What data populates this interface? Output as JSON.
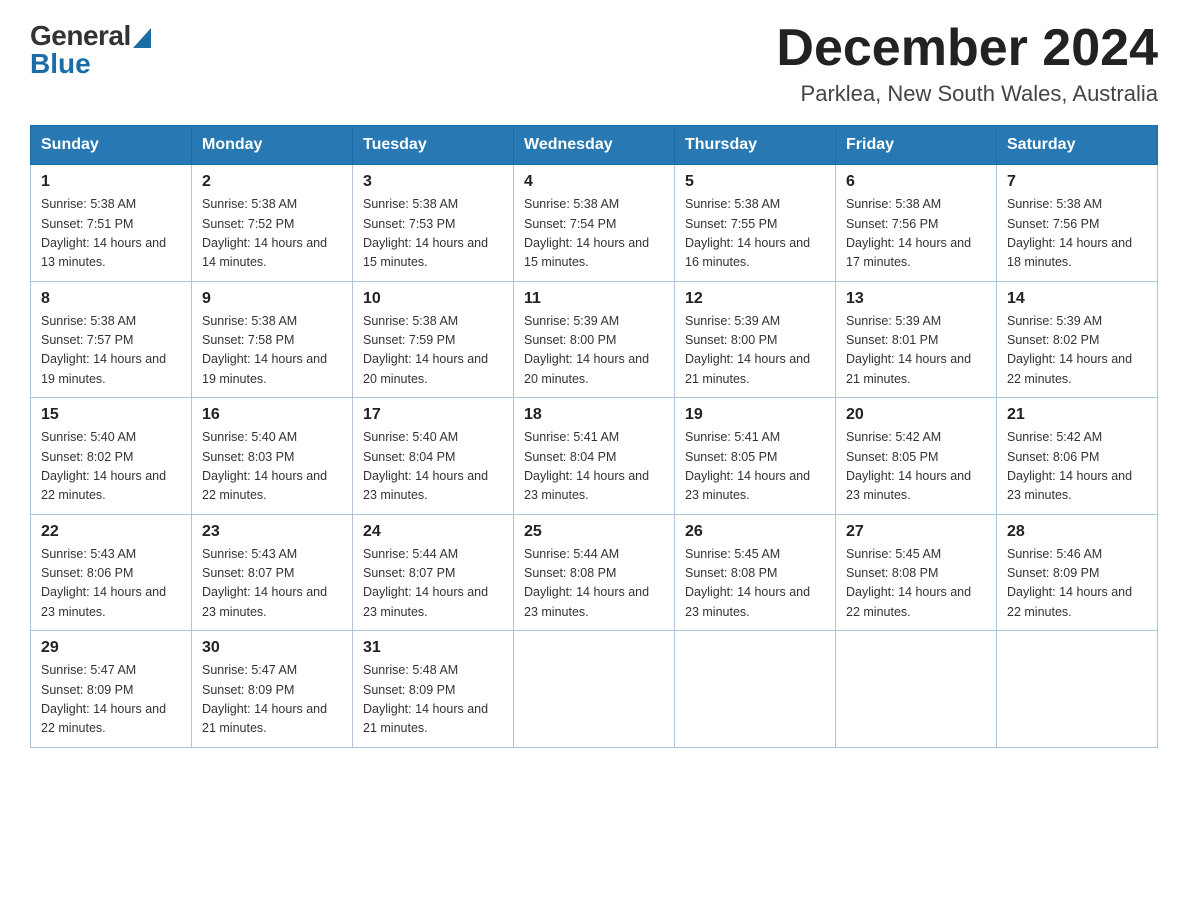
{
  "header": {
    "logo_general": "General",
    "logo_blue": "Blue",
    "month_title": "December 2024",
    "location": "Parklea, New South Wales, Australia"
  },
  "days_of_week": [
    "Sunday",
    "Monday",
    "Tuesday",
    "Wednesday",
    "Thursday",
    "Friday",
    "Saturday"
  ],
  "weeks": [
    [
      {
        "day": "1",
        "sunrise": "5:38 AM",
        "sunset": "7:51 PM",
        "daylight": "14 hours and 13 minutes."
      },
      {
        "day": "2",
        "sunrise": "5:38 AM",
        "sunset": "7:52 PM",
        "daylight": "14 hours and 14 minutes."
      },
      {
        "day": "3",
        "sunrise": "5:38 AM",
        "sunset": "7:53 PM",
        "daylight": "14 hours and 15 minutes."
      },
      {
        "day": "4",
        "sunrise": "5:38 AM",
        "sunset": "7:54 PM",
        "daylight": "14 hours and 15 minutes."
      },
      {
        "day": "5",
        "sunrise": "5:38 AM",
        "sunset": "7:55 PM",
        "daylight": "14 hours and 16 minutes."
      },
      {
        "day": "6",
        "sunrise": "5:38 AM",
        "sunset": "7:56 PM",
        "daylight": "14 hours and 17 minutes."
      },
      {
        "day": "7",
        "sunrise": "5:38 AM",
        "sunset": "7:56 PM",
        "daylight": "14 hours and 18 minutes."
      }
    ],
    [
      {
        "day": "8",
        "sunrise": "5:38 AM",
        "sunset": "7:57 PM",
        "daylight": "14 hours and 19 minutes."
      },
      {
        "day": "9",
        "sunrise": "5:38 AM",
        "sunset": "7:58 PM",
        "daylight": "14 hours and 19 minutes."
      },
      {
        "day": "10",
        "sunrise": "5:38 AM",
        "sunset": "7:59 PM",
        "daylight": "14 hours and 20 minutes."
      },
      {
        "day": "11",
        "sunrise": "5:39 AM",
        "sunset": "8:00 PM",
        "daylight": "14 hours and 20 minutes."
      },
      {
        "day": "12",
        "sunrise": "5:39 AM",
        "sunset": "8:00 PM",
        "daylight": "14 hours and 21 minutes."
      },
      {
        "day": "13",
        "sunrise": "5:39 AM",
        "sunset": "8:01 PM",
        "daylight": "14 hours and 21 minutes."
      },
      {
        "day": "14",
        "sunrise": "5:39 AM",
        "sunset": "8:02 PM",
        "daylight": "14 hours and 22 minutes."
      }
    ],
    [
      {
        "day": "15",
        "sunrise": "5:40 AM",
        "sunset": "8:02 PM",
        "daylight": "14 hours and 22 minutes."
      },
      {
        "day": "16",
        "sunrise": "5:40 AM",
        "sunset": "8:03 PM",
        "daylight": "14 hours and 22 minutes."
      },
      {
        "day": "17",
        "sunrise": "5:40 AM",
        "sunset": "8:04 PM",
        "daylight": "14 hours and 23 minutes."
      },
      {
        "day": "18",
        "sunrise": "5:41 AM",
        "sunset": "8:04 PM",
        "daylight": "14 hours and 23 minutes."
      },
      {
        "day": "19",
        "sunrise": "5:41 AM",
        "sunset": "8:05 PM",
        "daylight": "14 hours and 23 minutes."
      },
      {
        "day": "20",
        "sunrise": "5:42 AM",
        "sunset": "8:05 PM",
        "daylight": "14 hours and 23 minutes."
      },
      {
        "day": "21",
        "sunrise": "5:42 AM",
        "sunset": "8:06 PM",
        "daylight": "14 hours and 23 minutes."
      }
    ],
    [
      {
        "day": "22",
        "sunrise": "5:43 AM",
        "sunset": "8:06 PM",
        "daylight": "14 hours and 23 minutes."
      },
      {
        "day": "23",
        "sunrise": "5:43 AM",
        "sunset": "8:07 PM",
        "daylight": "14 hours and 23 minutes."
      },
      {
        "day": "24",
        "sunrise": "5:44 AM",
        "sunset": "8:07 PM",
        "daylight": "14 hours and 23 minutes."
      },
      {
        "day": "25",
        "sunrise": "5:44 AM",
        "sunset": "8:08 PM",
        "daylight": "14 hours and 23 minutes."
      },
      {
        "day": "26",
        "sunrise": "5:45 AM",
        "sunset": "8:08 PM",
        "daylight": "14 hours and 23 minutes."
      },
      {
        "day": "27",
        "sunrise": "5:45 AM",
        "sunset": "8:08 PM",
        "daylight": "14 hours and 22 minutes."
      },
      {
        "day": "28",
        "sunrise": "5:46 AM",
        "sunset": "8:09 PM",
        "daylight": "14 hours and 22 minutes."
      }
    ],
    [
      {
        "day": "29",
        "sunrise": "5:47 AM",
        "sunset": "8:09 PM",
        "daylight": "14 hours and 22 minutes."
      },
      {
        "day": "30",
        "sunrise": "5:47 AM",
        "sunset": "8:09 PM",
        "daylight": "14 hours and 21 minutes."
      },
      {
        "day": "31",
        "sunrise": "5:48 AM",
        "sunset": "8:09 PM",
        "daylight": "14 hours and 21 minutes."
      },
      null,
      null,
      null,
      null
    ]
  ]
}
